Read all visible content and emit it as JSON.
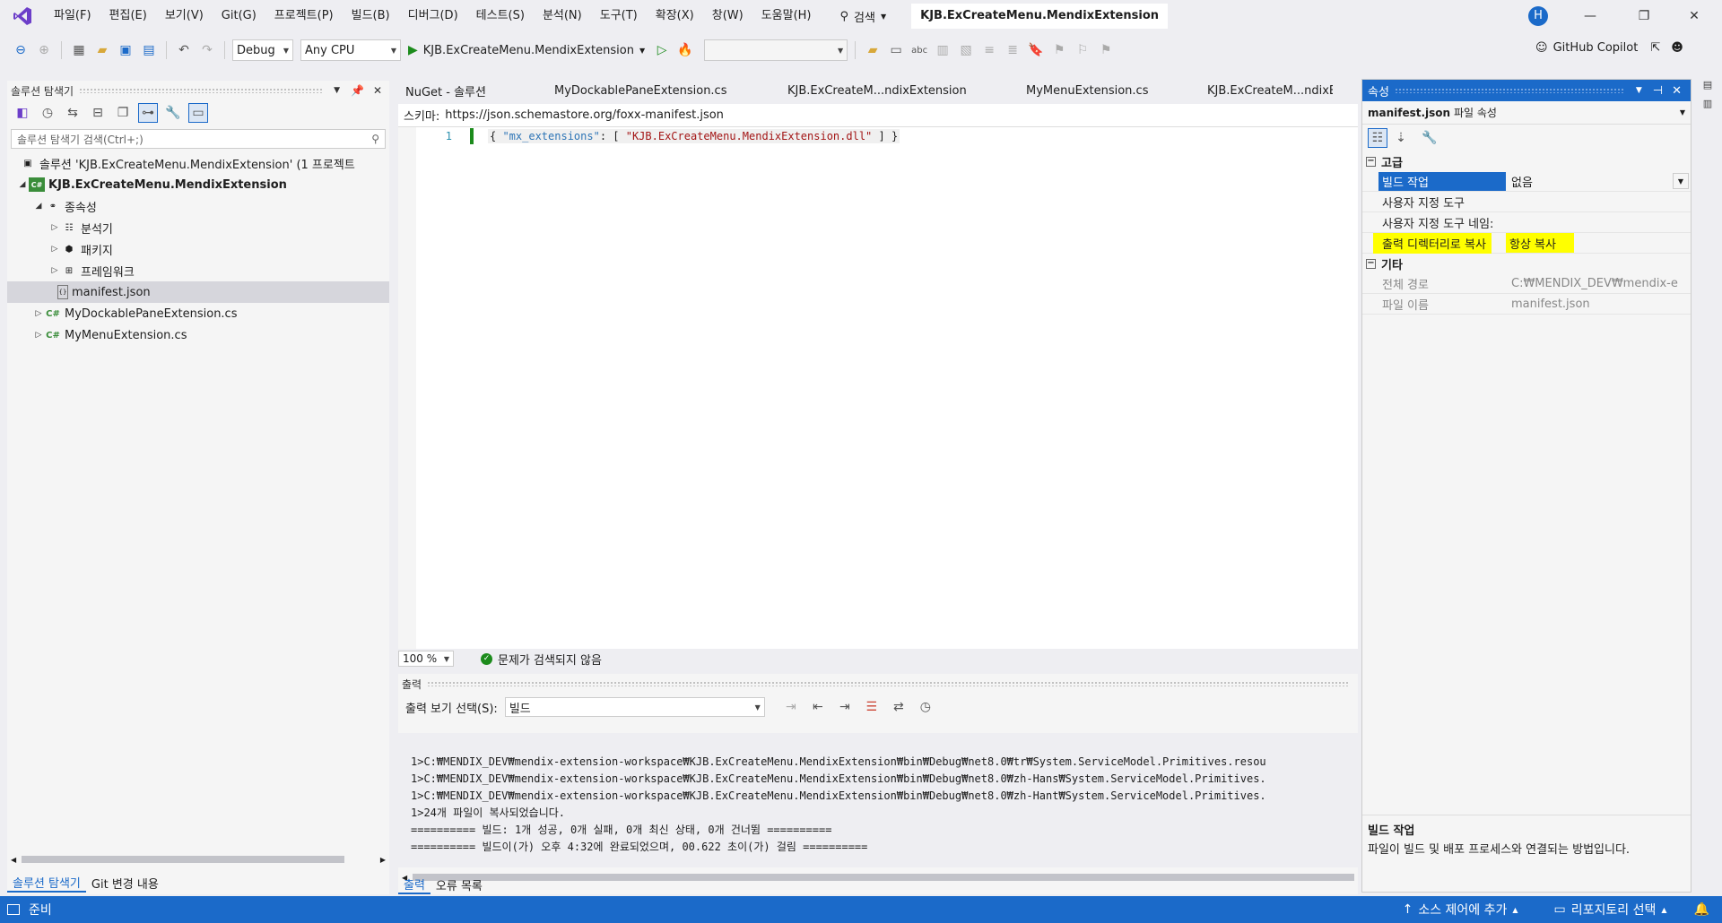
{
  "menu": [
    "파일(F)",
    "편집(E)",
    "보기(V)",
    "Git(G)",
    "프로젝트(P)",
    "빌드(B)",
    "디버그(D)",
    "테스트(S)",
    "분석(N)",
    "도구(T)",
    "확장(X)",
    "창(W)",
    "도움말(H)"
  ],
  "search_label": "검색",
  "window_title": "KJB.ExCreateMenu.MendixExtension",
  "avatar_letter": "H",
  "toolbar": {
    "config": "Debug",
    "platform": "Any CPU",
    "run_target": "KJB.ExCreateMenu.MendixExtension",
    "copilot": "GitHub Copilot"
  },
  "solution_explorer": {
    "title": "솔루션 탐색기",
    "search_placeholder": "솔루션 탐색기 검색(Ctrl+;)",
    "items": [
      {
        "label": "솔루션 'KJB.ExCreateMenu.MendixExtension' (1 프로젝트"
      },
      {
        "label": "KJB.ExCreateMenu.MendixExtension"
      },
      {
        "label": "종속성"
      },
      {
        "label": "분석기"
      },
      {
        "label": "패키지"
      },
      {
        "label": "프레임워크"
      },
      {
        "label": "manifest.json"
      },
      {
        "label": "MyDockablePaneExtension.cs"
      },
      {
        "label": "MyMenuExtension.cs"
      }
    ],
    "tab_solution": "솔루션 탐색기",
    "tab_git": "Git 변경 내용"
  },
  "editor": {
    "tabs": [
      "NuGet - 솔루션",
      "MyDockablePaneExtension.cs",
      "KJB.ExCreateM...ndixExtension",
      "MyMenuExtension.cs",
      "KJB.ExCreateM...ndixExt"
    ],
    "schema_label": "스키마:",
    "schema_url": "https://json.schemastore.org/foxx-manifest.json",
    "line_number": "1",
    "code_open": "{ ",
    "code_key": "\"mx_extensions\"",
    "code_mid": ": [ ",
    "code_value": "\"KJB.ExCreateMenu.MendixExtension.dll\"",
    "code_close": " ] }",
    "zoom": "100 %",
    "status": "문제가 검색되지 않음"
  },
  "output": {
    "title": "출력",
    "source_label": "출력 보기 선택(S):",
    "source_value": "빌드",
    "lines": [
      "1>C:₩MENDIX_DEV₩mendix-extension-workspace₩KJB.ExCreateMenu.MendixExtension₩bin₩Debug₩net8.0₩tr₩System.ServiceModel.Primitives.resou",
      "1>C:₩MENDIX_DEV₩mendix-extension-workspace₩KJB.ExCreateMenu.MendixExtension₩bin₩Debug₩net8.0₩zh-Hans₩System.ServiceModel.Primitives.",
      "1>C:₩MENDIX_DEV₩mendix-extension-workspace₩KJB.ExCreateMenu.MendixExtension₩bin₩Debug₩net8.0₩zh-Hant₩System.ServiceModel.Primitives.",
      "1>24개 파일이 복사되었습니다.",
      "========== 빌드: 1개 성공, 0개 실패, 0개 최신 상태, 0개 건너뜀 ==========",
      "========== 빌드이(가) 오후 4:32에 완료되었으며, 00.622 초이(가) 걸림 =========="
    ],
    "tab_output": "출력",
    "tab_errors": "오류 목록"
  },
  "properties": {
    "title": "속성",
    "object_name": "manifest.json",
    "object_type": "파일 속성",
    "cat_advanced": "고급",
    "rows_advanced": [
      {
        "name": "빌드 작업",
        "value": "없음"
      },
      {
        "name": "사용자 지정 도구",
        "value": ""
      },
      {
        "name": "사용자 지정 도구 네임:",
        "value": ""
      },
      {
        "name": "출력 디렉터리로 복사",
        "value": "항상 복사"
      }
    ],
    "cat_misc": "기타",
    "rows_misc": [
      {
        "name": "전체 경로",
        "value": "C:₩MENDIX_DEV₩mendix-e"
      },
      {
        "name": "파일 이름",
        "value": "manifest.json"
      }
    ],
    "desc_title": "빌드 작업",
    "desc_text": "파일이 빌드 및 배포 프로세스와 연결되는 방법입니다.",
    "highlight_color": "#ffff00",
    "selected_color": "#1b6ac9"
  },
  "statusbar": {
    "ready": "준비",
    "source_control": "소스 제어에 추가",
    "repo": "리포지토리 선택"
  }
}
